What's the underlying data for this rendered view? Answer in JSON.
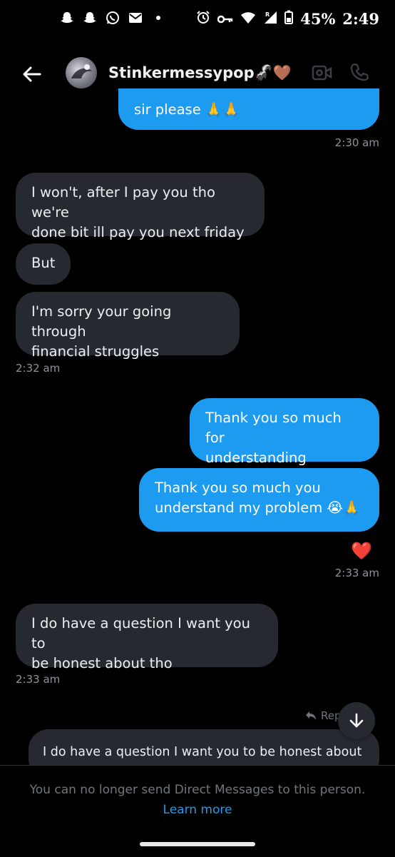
{
  "status_bar": {
    "battery": "45%",
    "time": "2:49"
  },
  "header": {
    "contact_name": "Stinkermessypop",
    "name_emoji": "🦨🤎"
  },
  "messages": [
    {
      "side": "out",
      "text": "sir please 🙏🙏"
    },
    {
      "side": "in",
      "lines": [
        "I won't, after I pay you tho we're",
        "done bit ill pay you next friday"
      ]
    },
    {
      "side": "in",
      "text": "But"
    },
    {
      "side": "in",
      "lines": [
        "I'm sorry your going through",
        "financial struggles"
      ]
    },
    {
      "side": "out",
      "lines": [
        "Thank you so much for",
        "understanding"
      ]
    },
    {
      "side": "out",
      "lines": [
        "Thank you so much you",
        "understand my problem 😭🙏"
      ]
    },
    {
      "side": "in",
      "lines": [
        "I do have a question I want you to",
        "be honest about tho"
      ]
    }
  ],
  "timestamps": {
    "t1": "2:30 am",
    "t2": "2:32 am",
    "t3": "2:33 am",
    "t4": "2:33 am"
  },
  "reaction": "❤️",
  "reply": {
    "label": "Reply",
    "quoted_text": "I do have a question I want you to be honest about tho"
  },
  "footer": {
    "notice": "You can no longer send Direct Messages to this person.",
    "link": "Learn more"
  },
  "colors": {
    "outgoing": "#1d9bf0",
    "incoming": "#262a30",
    "background": "#000000"
  }
}
